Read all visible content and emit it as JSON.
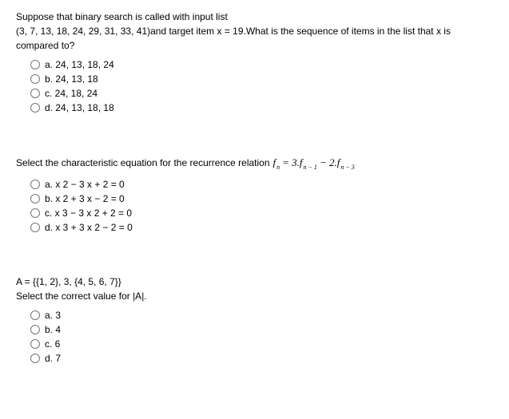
{
  "q1": {
    "line1": "Suppose that binary search is called with input list",
    "line2": "(3, 7, 13, 18, 24, 29, 31, 33, 41)and target item x = 19.What is the sequence of items in the list that x is compared to?",
    "opts": {
      "a": "a. 24, 13, 18, 24",
      "b": "b. 24, 13, 18",
      "c": "c. 24, 18, 24",
      "d": "d. 24, 13, 18, 18"
    }
  },
  "q2": {
    "prefix": "Select the characteristic equation for the recurrence relation",
    "formula": {
      "p1": "f",
      "s1": "n",
      "p2": "= 3.f",
      "s2": "n − 1",
      "p3": "− 2.f",
      "s3": "n − 3"
    },
    "opts": {
      "a": "a. x 2 − 3 x + 2 = 0",
      "b": "b. x 2 + 3 x − 2 = 0",
      "c": "c. x 3 − 3 x 2 + 2 = 0",
      "d": "d. x 3 + 3 x 2 − 2 = 0"
    }
  },
  "q3": {
    "line1": "A = {{1, 2}, 3, {4, 5, 6, 7}}",
    "line2": "Select the correct value for |A|.",
    "opts": {
      "a": "a. 3",
      "b": "b. 4",
      "c": "c. 6",
      "d": "d. 7"
    }
  }
}
